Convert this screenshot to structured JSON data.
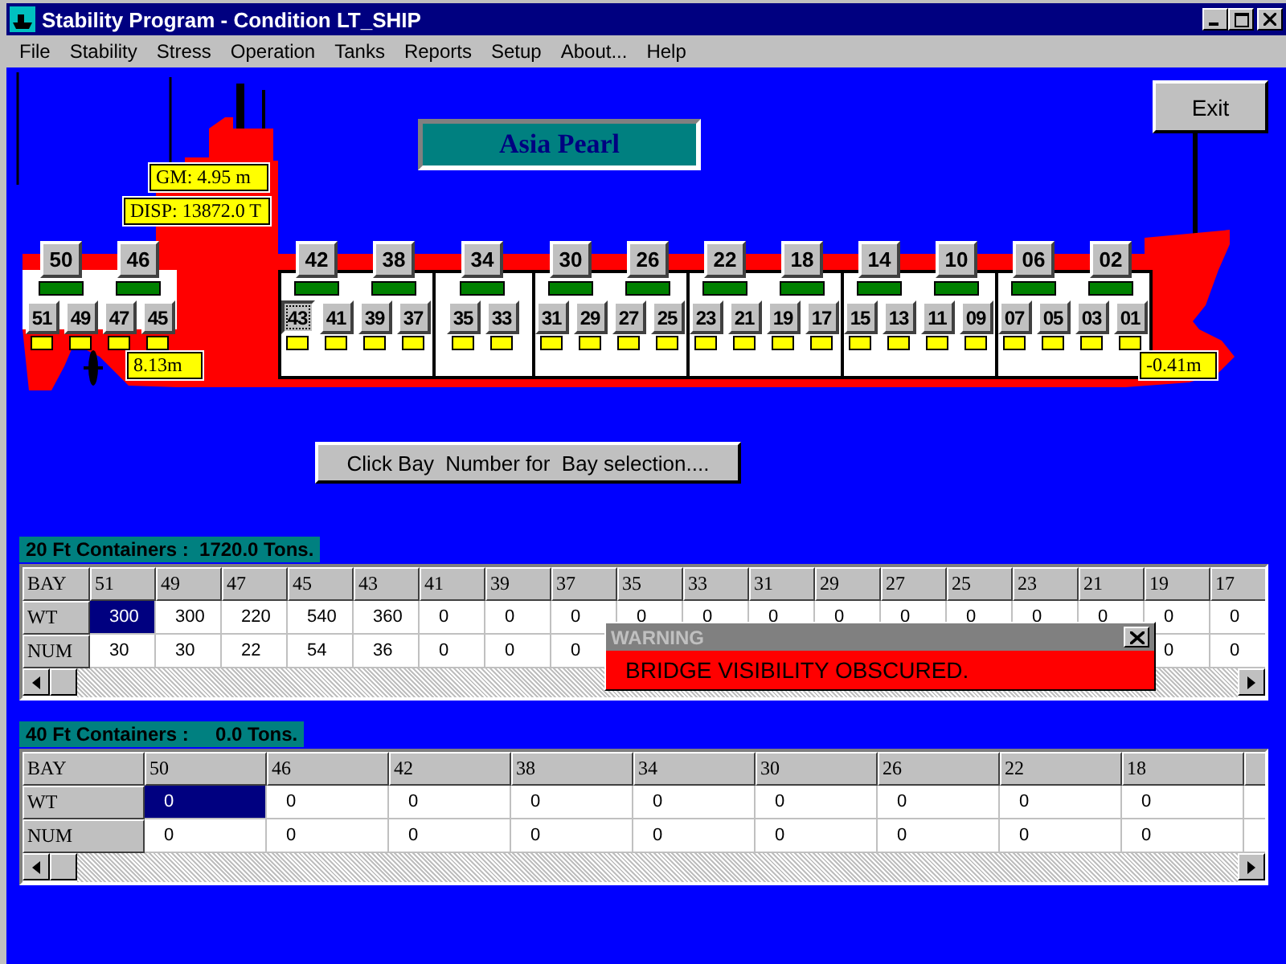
{
  "window": {
    "title": "Stability Program - Condition LT_SHIP"
  },
  "menu": [
    "File",
    "Stability",
    "Stress",
    "Operation",
    "Tanks",
    "Reports",
    "Setup",
    "About...",
    "Help"
  ],
  "exit_button": "Exit",
  "ship": {
    "name": "Asia Pearl",
    "gm": "GM: 4.95 m",
    "displacement": "DISP: 13872.0 T",
    "draft_aft": "8.13m",
    "draft_fwd": "-0.41m",
    "holds": [
      {
        "kind": "aft",
        "pairs": [
          {
            "bay40": {
              "label": "50",
              "selected": false
            },
            "bays20": [
              {
                "label": "51",
                "selected": false
              },
              {
                "label": "49",
                "selected": false
              }
            ]
          },
          {
            "bay40": {
              "label": "46",
              "selected": false
            },
            "bays20": [
              {
                "label": "47",
                "selected": false
              },
              {
                "label": "45",
                "selected": false
              }
            ]
          }
        ]
      },
      {
        "kind": "hold",
        "pairs": [
          {
            "bay40": {
              "label": "42",
              "selected": false
            },
            "bays20": [
              {
                "label": "43",
                "selected": true
              },
              {
                "label": "41",
                "selected": false
              }
            ]
          },
          {
            "bay40": {
              "label": "38",
              "selected": false
            },
            "bays20": [
              {
                "label": "39",
                "selected": false
              },
              {
                "label": "37",
                "selected": false
              }
            ]
          }
        ]
      },
      {
        "kind": "hold",
        "pairs": [
          {
            "bay40": {
              "label": "34",
              "selected": false
            },
            "bays20": [
              {
                "label": "35",
                "selected": false
              },
              {
                "label": "33",
                "selected": false
              }
            ]
          }
        ]
      },
      {
        "kind": "hold",
        "pairs": [
          {
            "bay40": {
              "label": "30",
              "selected": false
            },
            "bays20": [
              {
                "label": "31",
                "selected": false
              },
              {
                "label": "29",
                "selected": false
              }
            ]
          },
          {
            "bay40": {
              "label": "26",
              "selected": false
            },
            "bays20": [
              {
                "label": "27",
                "selected": false
              },
              {
                "label": "25",
                "selected": false
              }
            ]
          }
        ]
      },
      {
        "kind": "hold",
        "pairs": [
          {
            "bay40": {
              "label": "22",
              "selected": false
            },
            "bays20": [
              {
                "label": "23",
                "selected": false
              },
              {
                "label": "21",
                "selected": false
              }
            ]
          },
          {
            "bay40": {
              "label": "18",
              "selected": false
            },
            "bays20": [
              {
                "label": "19",
                "selected": false
              },
              {
                "label": "17",
                "selected": false
              }
            ]
          }
        ]
      },
      {
        "kind": "hold",
        "pairs": [
          {
            "bay40": {
              "label": "14",
              "selected": false
            },
            "bays20": [
              {
                "label": "15",
                "selected": false
              },
              {
                "label": "13",
                "selected": false
              }
            ]
          },
          {
            "bay40": {
              "label": "10",
              "selected": false
            },
            "bays20": [
              {
                "label": "11",
                "selected": false
              },
              {
                "label": "09",
                "selected": false
              }
            ]
          }
        ]
      },
      {
        "kind": "hold",
        "pairs": [
          {
            "bay40": {
              "label": "06",
              "selected": false
            },
            "bays20": [
              {
                "label": "07",
                "selected": false
              },
              {
                "label": "05",
                "selected": false
              }
            ]
          },
          {
            "bay40": {
              "label": "02",
              "selected": false
            },
            "bays20": [
              {
                "label": "03",
                "selected": false
              },
              {
                "label": "01",
                "selected": false
              }
            ]
          }
        ]
      }
    ]
  },
  "bay_selection_button": "Click Bay  Number for  Bay selection....",
  "containers_20ft": {
    "caption": "20 Ft Containers :  1720.0 Tons.",
    "corner": "BAY",
    "columns": [
      "51",
      "49",
      "47",
      "45",
      "43",
      "41",
      "39",
      "37",
      "35",
      "33",
      "31",
      "29",
      "27",
      "25",
      "23",
      "21",
      "19",
      "17"
    ],
    "rows": [
      {
        "label": "WT",
        "cells": [
          {
            "text": "300",
            "selected": true
          },
          {
            "text": "300",
            "selected": false
          },
          {
            "text": "220",
            "selected": false
          },
          {
            "text": "540",
            "selected": false
          },
          {
            "text": "360",
            "selected": false
          },
          {
            "text": "0",
            "selected": false
          },
          {
            "text": "0",
            "selected": false
          },
          {
            "text": "0",
            "selected": false
          },
          {
            "text": "0",
            "selected": false
          },
          {
            "text": "0",
            "selected": false
          },
          {
            "text": "0",
            "selected": false
          },
          {
            "text": "0",
            "selected": false
          },
          {
            "text": "0",
            "selected": false
          },
          {
            "text": "0",
            "selected": false
          },
          {
            "text": "0",
            "selected": false
          },
          {
            "text": "0",
            "selected": false
          },
          {
            "text": "0",
            "selected": false
          },
          {
            "text": "0",
            "selected": false
          }
        ]
      },
      {
        "label": "NUM",
        "cells": [
          {
            "text": "30",
            "selected": false
          },
          {
            "text": "30",
            "selected": false
          },
          {
            "text": "22",
            "selected": false
          },
          {
            "text": "54",
            "selected": false
          },
          {
            "text": "36",
            "selected": false
          },
          {
            "text": "0",
            "selected": false
          },
          {
            "text": "0",
            "selected": false
          },
          {
            "text": "0",
            "selected": false
          },
          {
            "text": null
          },
          {
            "text": null
          },
          {
            "text": null
          },
          {
            "text": null
          },
          {
            "text": null
          },
          {
            "text": null
          },
          {
            "text": null
          },
          {
            "text": null
          },
          {
            "text": "0",
            "selected": false
          },
          {
            "text": "0",
            "selected": false
          }
        ]
      }
    ]
  },
  "warning": {
    "title": "WARNING",
    "message": "BRIDGE VISIBILITY OBSCURED."
  },
  "containers_40ft": {
    "caption": "40 Ft Containers :     0.0 Tons.",
    "corner": "BAY",
    "columns": [
      "50",
      "46",
      "42",
      "38",
      "34",
      "30",
      "26",
      "22",
      "18"
    ],
    "rows": [
      {
        "label": "WT",
        "cells": [
          {
            "text": "0",
            "selected": true
          },
          {
            "text": "0",
            "selected": false
          },
          {
            "text": "0",
            "selected": false
          },
          {
            "text": "0",
            "selected": false
          },
          {
            "text": "0",
            "selected": false
          },
          {
            "text": "0",
            "selected": false
          },
          {
            "text": "0",
            "selected": false
          },
          {
            "text": "0",
            "selected": false
          },
          {
            "text": "0",
            "selected": false
          }
        ]
      },
      {
        "label": "NUM",
        "cells": [
          {
            "text": "0",
            "selected": false
          },
          {
            "text": "0",
            "selected": false
          },
          {
            "text": "0",
            "selected": false
          },
          {
            "text": "0",
            "selected": false
          },
          {
            "text": "0",
            "selected": false
          },
          {
            "text": "0",
            "selected": false
          },
          {
            "text": "0",
            "selected": false
          },
          {
            "text": "0",
            "selected": false
          },
          {
            "text": "0",
            "selected": false
          }
        ]
      }
    ]
  }
}
